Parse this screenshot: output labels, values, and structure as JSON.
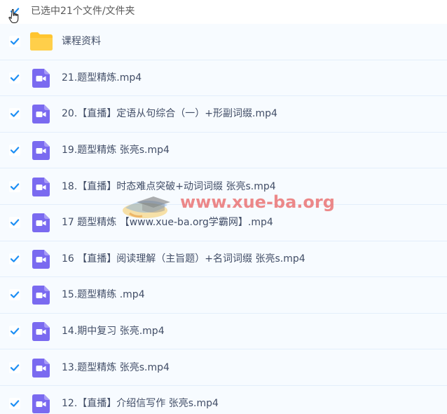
{
  "header": {
    "selection_text": "已选中21个文件/文件夹",
    "select_all_checked": true
  },
  "colors": {
    "checkbox_blue": "#1e8ff4",
    "video_icon_purple": "#7a6af0",
    "folder_yellow": "#ffc530",
    "row_bg": "#f7fbff",
    "row_border": "#e3eefb",
    "text": "#424e67"
  },
  "files": [
    {
      "name": "课程资料",
      "type": "folder",
      "icon": "folder-icon",
      "checked": true
    },
    {
      "name": "21.题型精炼.mp4",
      "type": "video",
      "icon": "video-file-icon",
      "checked": true
    },
    {
      "name": "20.【直播】定语从句综合（一）+形副词缀.mp4",
      "type": "video",
      "icon": "video-file-icon",
      "checked": true
    },
    {
      "name": "19.题型精炼 张亮s.mp4",
      "type": "video",
      "icon": "video-file-icon",
      "checked": true
    },
    {
      "name": "18.【直播】时态难点突破+动词词缀 张亮s.mp4",
      "type": "video",
      "icon": "video-file-icon",
      "checked": true
    },
    {
      "name": "17 题型精炼 【www.xue-ba.org学霸网】.mp4",
      "type": "video",
      "icon": "video-file-icon",
      "checked": true
    },
    {
      "name": "16 【直播】阅读理解（主旨题）+名词词缀 张亮s.mp4",
      "type": "video",
      "icon": "video-file-icon",
      "checked": true
    },
    {
      "name": "15.题型精练 .mp4",
      "type": "video",
      "icon": "video-file-icon",
      "checked": true
    },
    {
      "name": "14.期中复习 张亮.mp4",
      "type": "video",
      "icon": "video-file-icon",
      "checked": true
    },
    {
      "name": "13.题型精炼 张亮s.mp4",
      "type": "video",
      "icon": "video-file-icon",
      "checked": true
    },
    {
      "name": "12.【直播】介绍信写作 张亮s.mp4",
      "type": "video",
      "icon": "video-file-icon",
      "checked": true
    }
  ],
  "watermark": {
    "text": "www.xue-ba.org"
  }
}
